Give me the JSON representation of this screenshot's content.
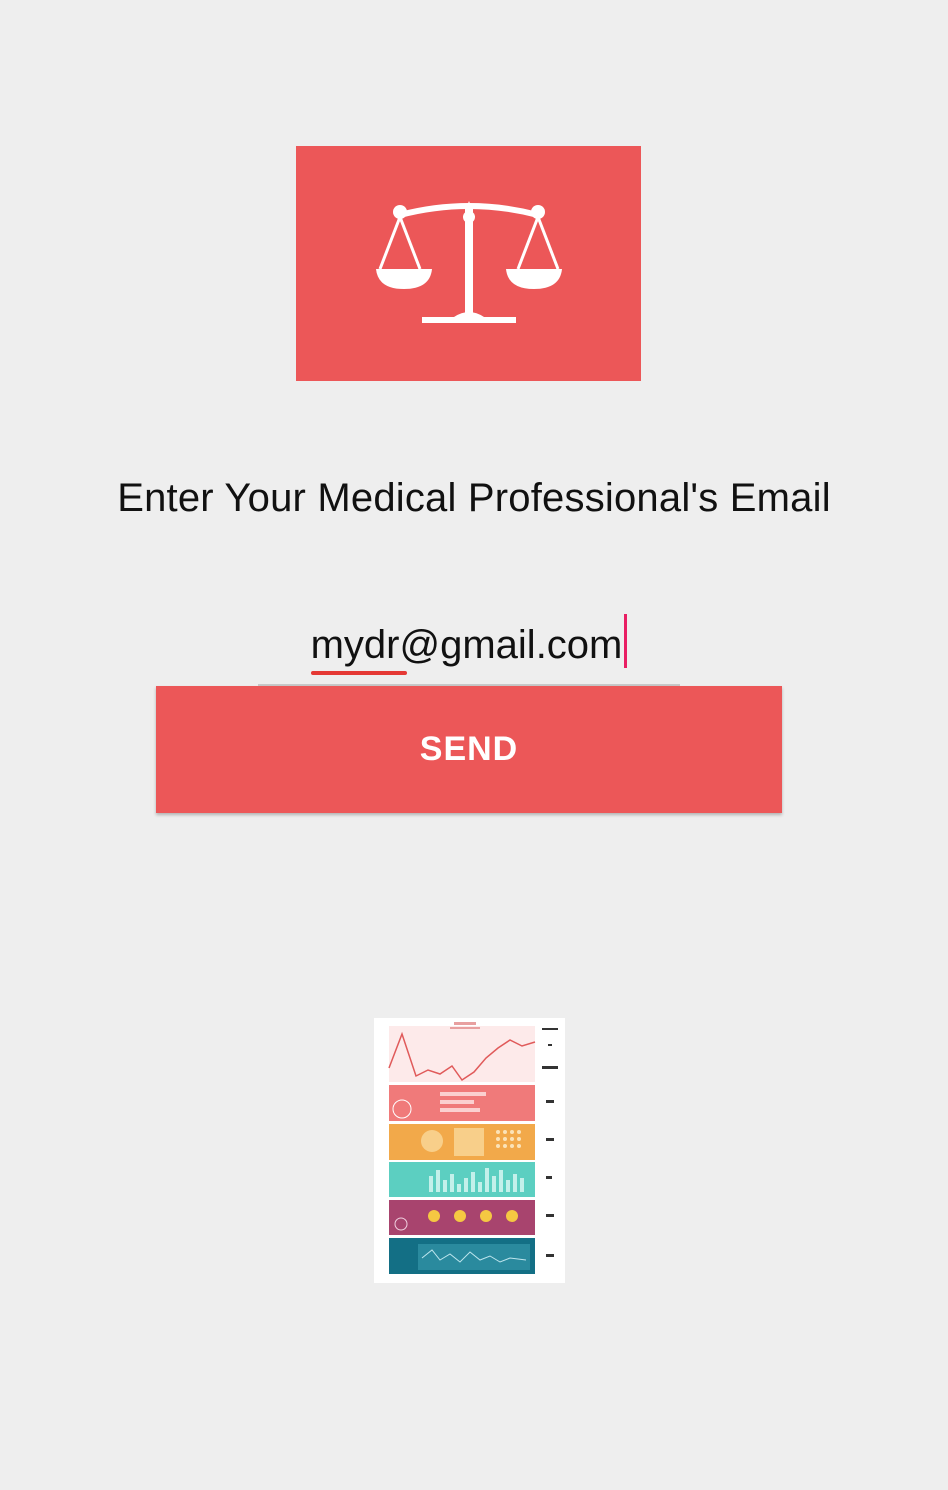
{
  "logo": {
    "icon": "balance-scale-icon",
    "background_color": "#ec5758",
    "icon_color": "#ffffff"
  },
  "prompt": {
    "text": "Enter Your Medical Professional's Email"
  },
  "email_input": {
    "value": "mydr@gmail.com",
    "cursor_color": "#e91e63",
    "spellcheck_underline_color": "#e53935"
  },
  "send_button": {
    "label": "SEND",
    "background_color": "#ec5758"
  },
  "report_thumbnail": {
    "icon": "health-report-infographic-image",
    "band_colors": [
      "#f07a7a",
      "#f2a94a",
      "#5ccfc1",
      "#a8446e",
      "#136f85"
    ]
  }
}
